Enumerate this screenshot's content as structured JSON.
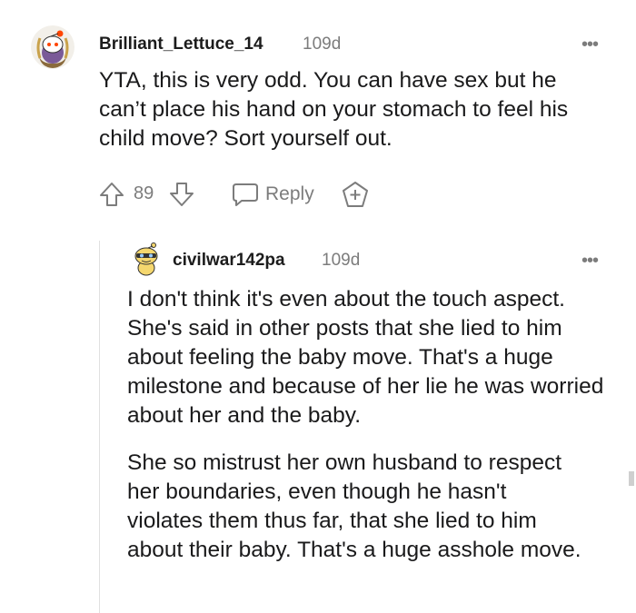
{
  "comment": {
    "username": "Brilliant_Lettuce_14",
    "age": "109d",
    "more": "•••",
    "body": "YTA, this is very odd. You can have sex but he can’t place his hand on your stomach to feel his child move? Sort yourself out.",
    "votes": "89",
    "reply_label": "Reply"
  },
  "reply": {
    "username": "civilwar142pa",
    "age": "109d",
    "more": "•••",
    "paragraph1": "I don't think it's even about the touch aspect. She's said in other posts that she lied to him about feeling the baby move. That's a huge milestone and because of her lie he was worried about her and the baby.",
    "paragraph2": "She so mistrust her own husband to respect her boundaries, even though he hasn't violates them thus far, that she lied to him about their baby. That's a huge asshole move."
  },
  "icons": {
    "avatar1": "snoo-avatar-icon",
    "avatar2": "snoo-avatar-icon",
    "upvote": "arrow-up-icon",
    "downvote": "arrow-down-icon",
    "reply": "speech-bubble-icon",
    "award": "award-plus-icon"
  }
}
